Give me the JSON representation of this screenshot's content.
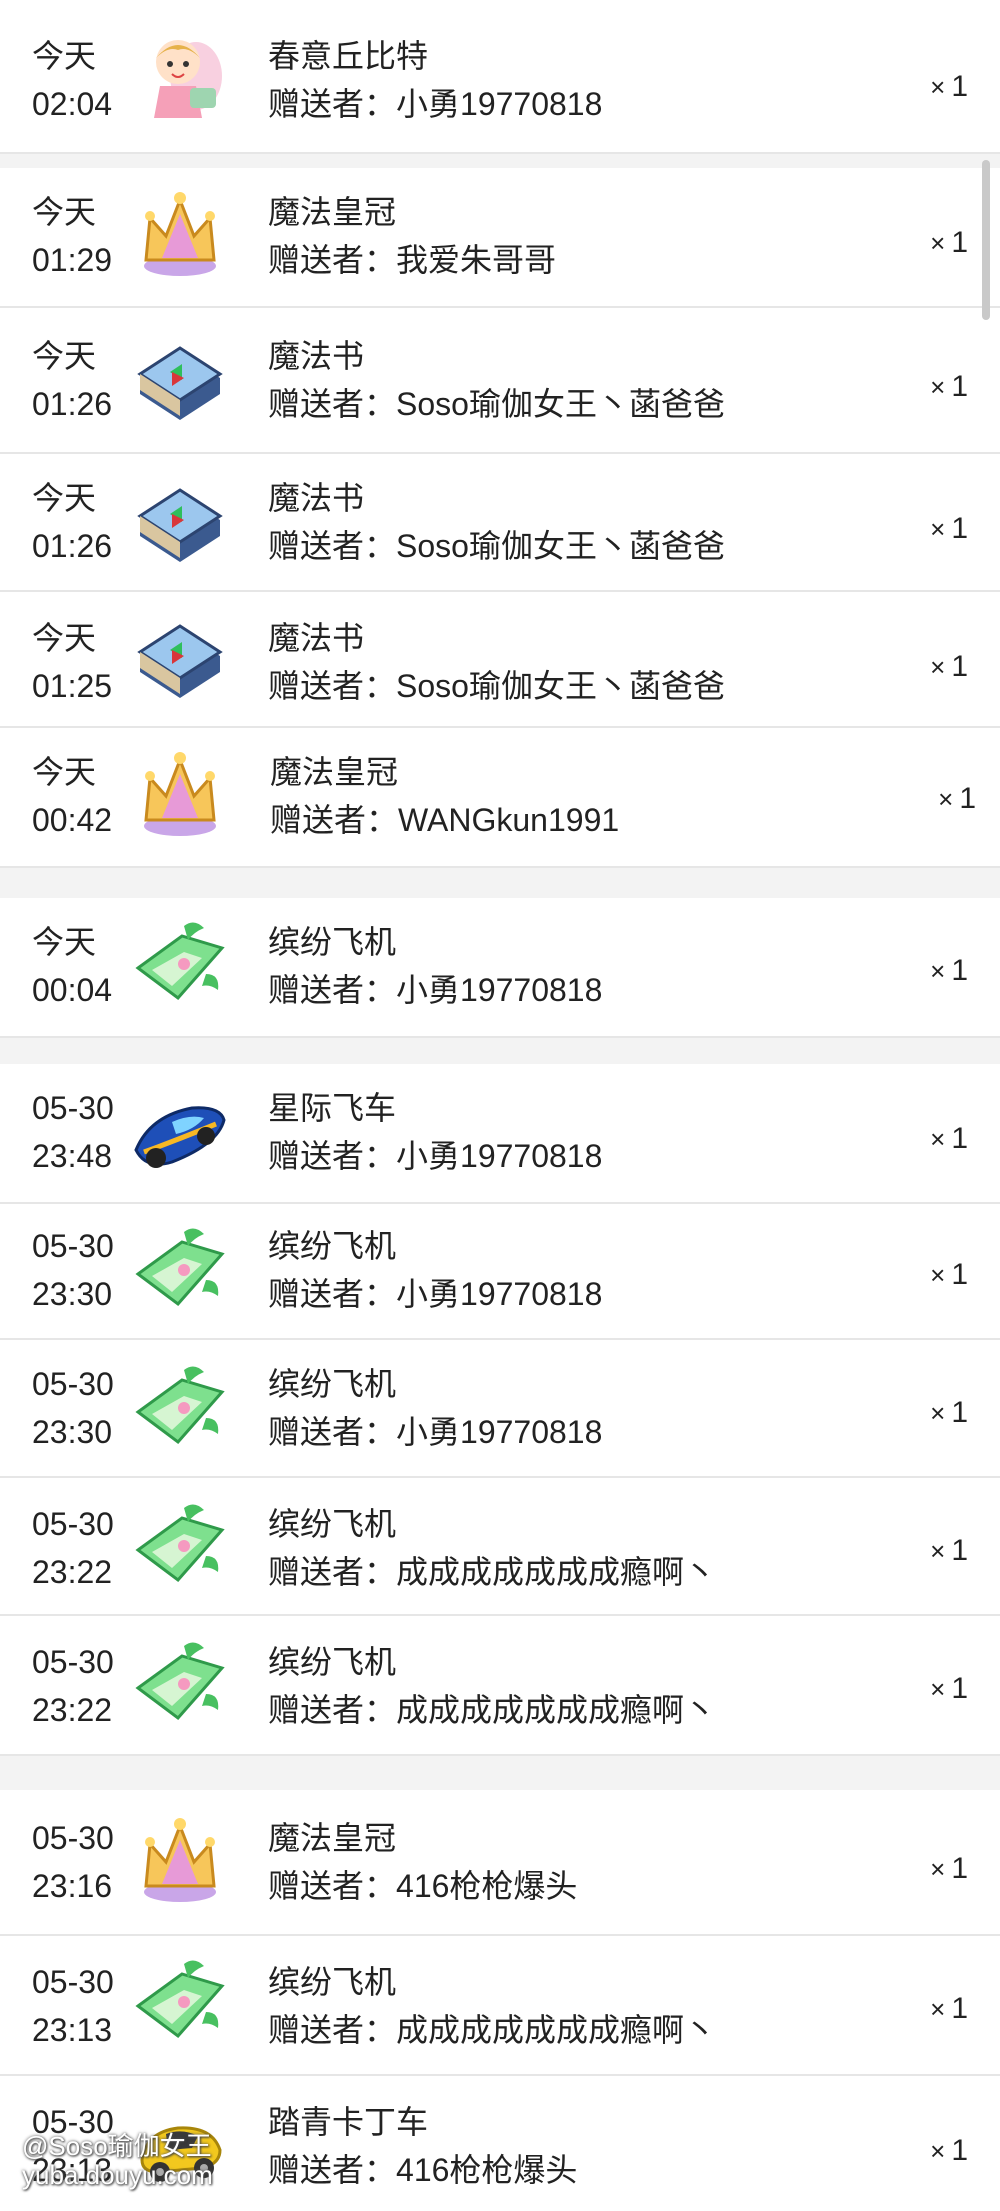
{
  "rows": [
    {
      "date": "今天",
      "time": "02:04",
      "gift": "春意丘比特",
      "giver_label": "赠送者：",
      "giver": "小勇19770818",
      "qty": "1",
      "icon": "cupid-icon"
    },
    {
      "date": "今天",
      "time": "01:29",
      "gift": "魔法皇冠",
      "giver_label": "赠送者：",
      "giver": "我爱朱哥哥",
      "qty": "1",
      "icon": "crown-icon"
    },
    {
      "date": "今天",
      "time": "01:26",
      "gift": "魔法书",
      "giver_label": "赠送者：",
      "giver": "Soso瑜伽女王丶菡爸爸",
      "qty": "1",
      "icon": "magic-book-icon"
    },
    {
      "date": "今天",
      "time": "01:26",
      "gift": "魔法书",
      "giver_label": "赠送者：",
      "giver": "Soso瑜伽女王丶菡爸爸",
      "qty": "1",
      "icon": "magic-book-icon"
    },
    {
      "date": "今天",
      "time": "01:25",
      "gift": "魔法书",
      "giver_label": "赠送者：",
      "giver": "Soso瑜伽女王丶菡爸爸",
      "qty": "1",
      "icon": "magic-book-icon"
    },
    {
      "date": "今天",
      "time": "00:42",
      "gift": "魔法皇冠",
      "giver_label": "赠送者：",
      "giver": "WANGkun1991",
      "qty": "1",
      "icon": "crown-icon"
    },
    {
      "date": "今天",
      "time": "00:04",
      "gift": "缤纷飞机",
      "giver_label": "赠送者：",
      "giver": "小勇19770818",
      "qty": "1",
      "icon": "plane-icon"
    },
    {
      "date": "05-30",
      "time": "23:48",
      "gift": "星际飞车",
      "giver_label": "赠送者：",
      "giver": "小勇19770818",
      "qty": "1",
      "icon": "race-car-icon"
    },
    {
      "date": "05-30",
      "time": "23:30",
      "gift": "缤纷飞机",
      "giver_label": "赠送者：",
      "giver": "小勇19770818",
      "qty": "1",
      "icon": "plane-icon"
    },
    {
      "date": "05-30",
      "time": "23:30",
      "gift": "缤纷飞机",
      "giver_label": "赠送者：",
      "giver": "小勇19770818",
      "qty": "1",
      "icon": "plane-icon"
    },
    {
      "date": "05-30",
      "time": "23:22",
      "gift": "缤纷飞机",
      "giver_label": "赠送者：",
      "giver": "成成成成成成成瘾啊丶",
      "qty": "1",
      "icon": "plane-icon"
    },
    {
      "date": "05-30",
      "time": "23:22",
      "gift": "缤纷飞机",
      "giver_label": "赠送者：",
      "giver": "成成成成成成成瘾啊丶",
      "qty": "1",
      "icon": "plane-icon"
    },
    {
      "date": "05-30",
      "time": "23:16",
      "gift": "魔法皇冠",
      "giver_label": "赠送者：",
      "giver": "416枪枪爆头",
      "qty": "1",
      "icon": "crown-icon"
    },
    {
      "date": "05-30",
      "time": "23:13",
      "gift": "缤纷飞机",
      "giver_label": "赠送者：",
      "giver": "成成成成成成成瘾啊丶",
      "qty": "1",
      "icon": "plane-icon"
    },
    {
      "date": "05-30",
      "time": "23:13",
      "gift": "踏青卡丁车",
      "giver_label": "赠送者：",
      "giver": "416枪枪爆头",
      "qty": "1",
      "icon": "kart-icon"
    }
  ],
  "qty_prefix": "×",
  "watermark": {
    "line1": "@Soso瑜伽女王",
    "line2": "yuba.douyu.com"
  }
}
